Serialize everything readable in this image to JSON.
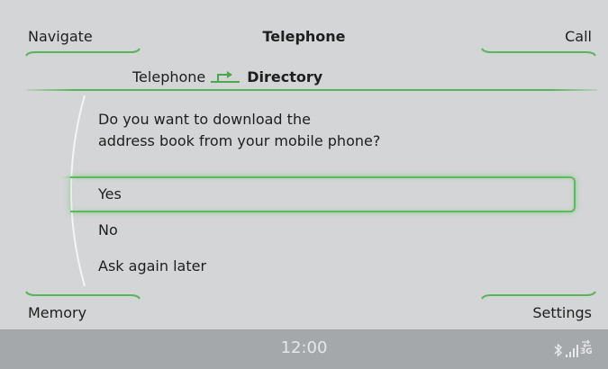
{
  "header": {
    "title": "Telephone",
    "navigate_label": "Navigate",
    "call_label": "Call"
  },
  "breadcrumb": {
    "parent": "Telephone",
    "current": "Directory"
  },
  "dialog": {
    "question_line1": "Do you want to download the",
    "question_line2": "address book from your mobile phone?",
    "options": [
      {
        "label": "Yes",
        "selected": true
      },
      {
        "label": "No",
        "selected": false
      },
      {
        "label": "Ask again later",
        "selected": false
      }
    ]
  },
  "footer": {
    "memory_label": "Memory",
    "settings_label": "Settings"
  },
  "statusbar": {
    "time": "12:00",
    "network": "3G",
    "icons": [
      "bluetooth-icon",
      "signal-strength-icon",
      "network-3g-icon"
    ]
  },
  "colors": {
    "background": "#d3d5d6",
    "accent_green": "#59b55a",
    "statusbar": "#a5a8ab"
  }
}
